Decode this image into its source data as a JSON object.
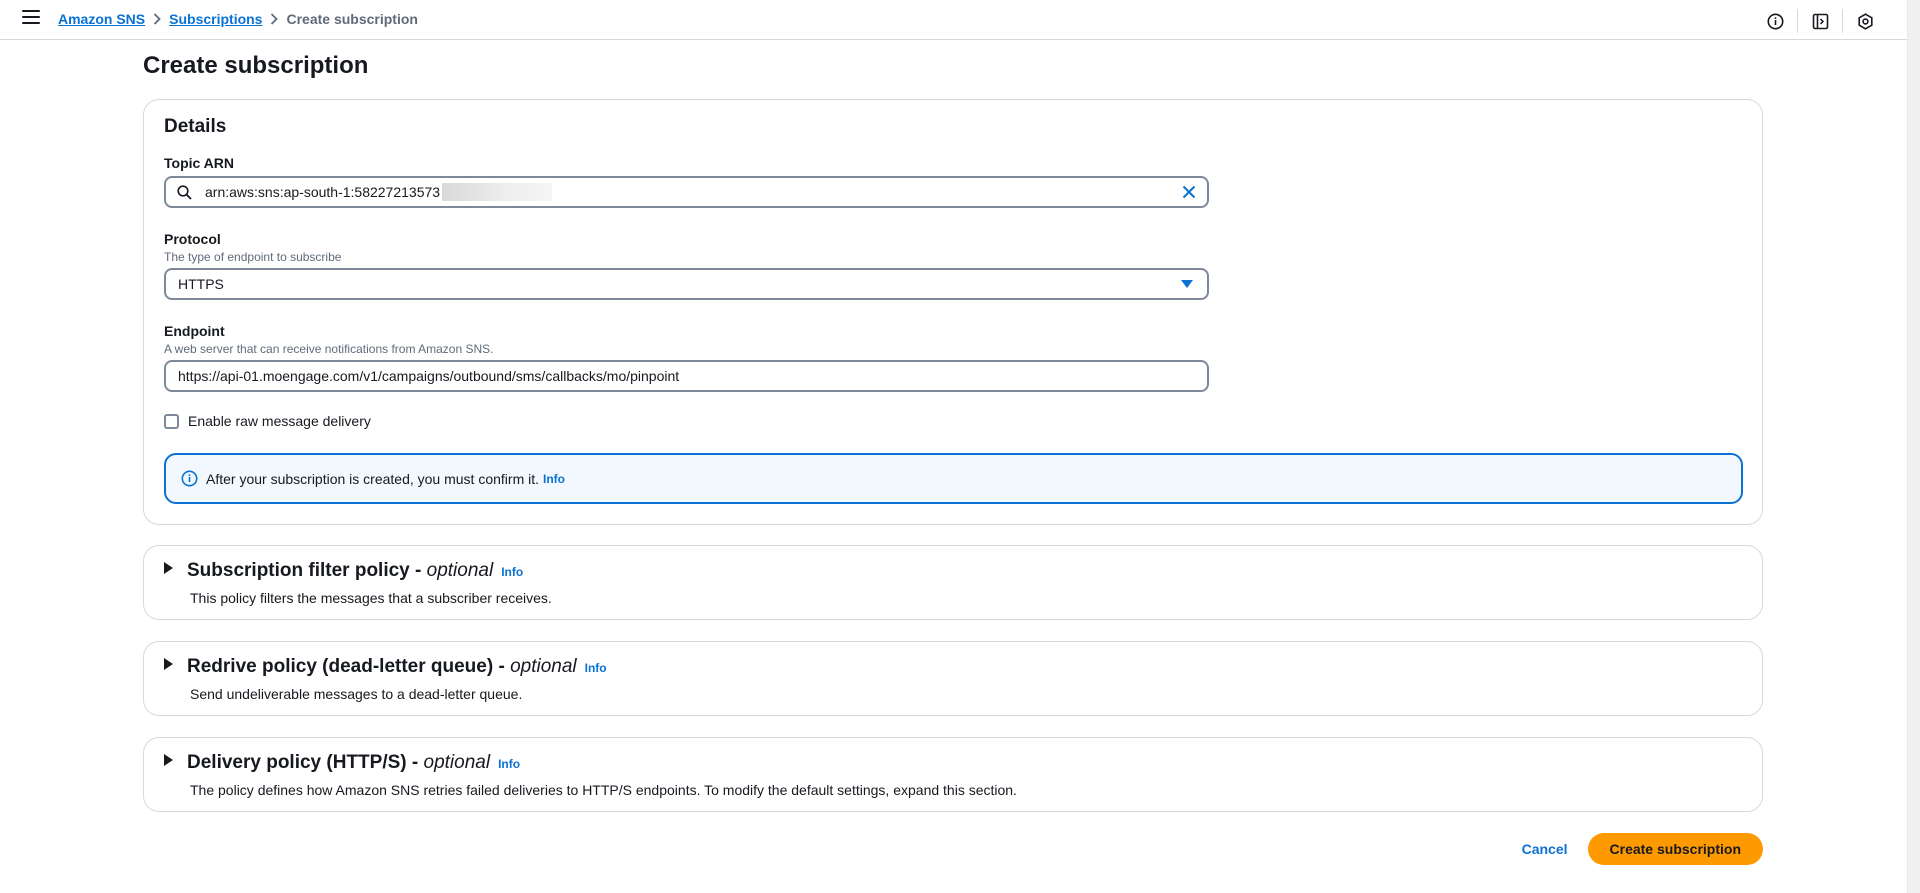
{
  "breadcrumb": {
    "root": "Amazon SNS",
    "section": "Subscriptions",
    "current": "Create subscription"
  },
  "page": {
    "title": "Create subscription"
  },
  "details": {
    "heading": "Details",
    "topic_arn": {
      "label": "Topic ARN",
      "value": "arn:aws:sns:ap-south-1:58227213573"
    },
    "protocol": {
      "label": "Protocol",
      "description": "The type of endpoint to subscribe",
      "selected": "HTTPS"
    },
    "endpoint": {
      "label": "Endpoint",
      "description": "A web server that can receive notifications from Amazon SNS.",
      "value": "https://api-01.moengage.com/v1/campaigns/outbound/sms/callbacks/mo/pinpoint"
    },
    "raw_delivery": {
      "label": "Enable raw message delivery",
      "checked": false
    },
    "alert": {
      "text": "After your subscription is created, you must confirm it.",
      "info": "Info"
    }
  },
  "sections": {
    "filter": {
      "title": "Subscription filter policy - ",
      "optional": "optional",
      "info": "Info",
      "description": "This policy filters the messages that a subscriber receives."
    },
    "redrive": {
      "title": "Redrive policy (dead-letter queue) - ",
      "optional": "optional",
      "info": "Info",
      "description": "Send undeliverable messages to a dead-letter queue."
    },
    "delivery": {
      "title": "Delivery policy (HTTP/S) - ",
      "optional": "optional",
      "info": "Info",
      "description": "The policy defines how Amazon SNS retries failed deliveries to HTTP/S endpoints. To modify the default settings, expand this section."
    }
  },
  "actions": {
    "cancel": "Cancel",
    "submit": "Create subscription"
  },
  "icons": {
    "menu": "hamburger-icon",
    "help": "info-circle-icon",
    "panel": "side-panel-icon",
    "settings": "gear-icon",
    "search": "search-icon",
    "clear": "close-icon",
    "dropdown": "caret-down-icon"
  },
  "colors": {
    "link": "#0972d3",
    "primary_button": "#ff9900",
    "alert_background": "#f2f8fd"
  }
}
